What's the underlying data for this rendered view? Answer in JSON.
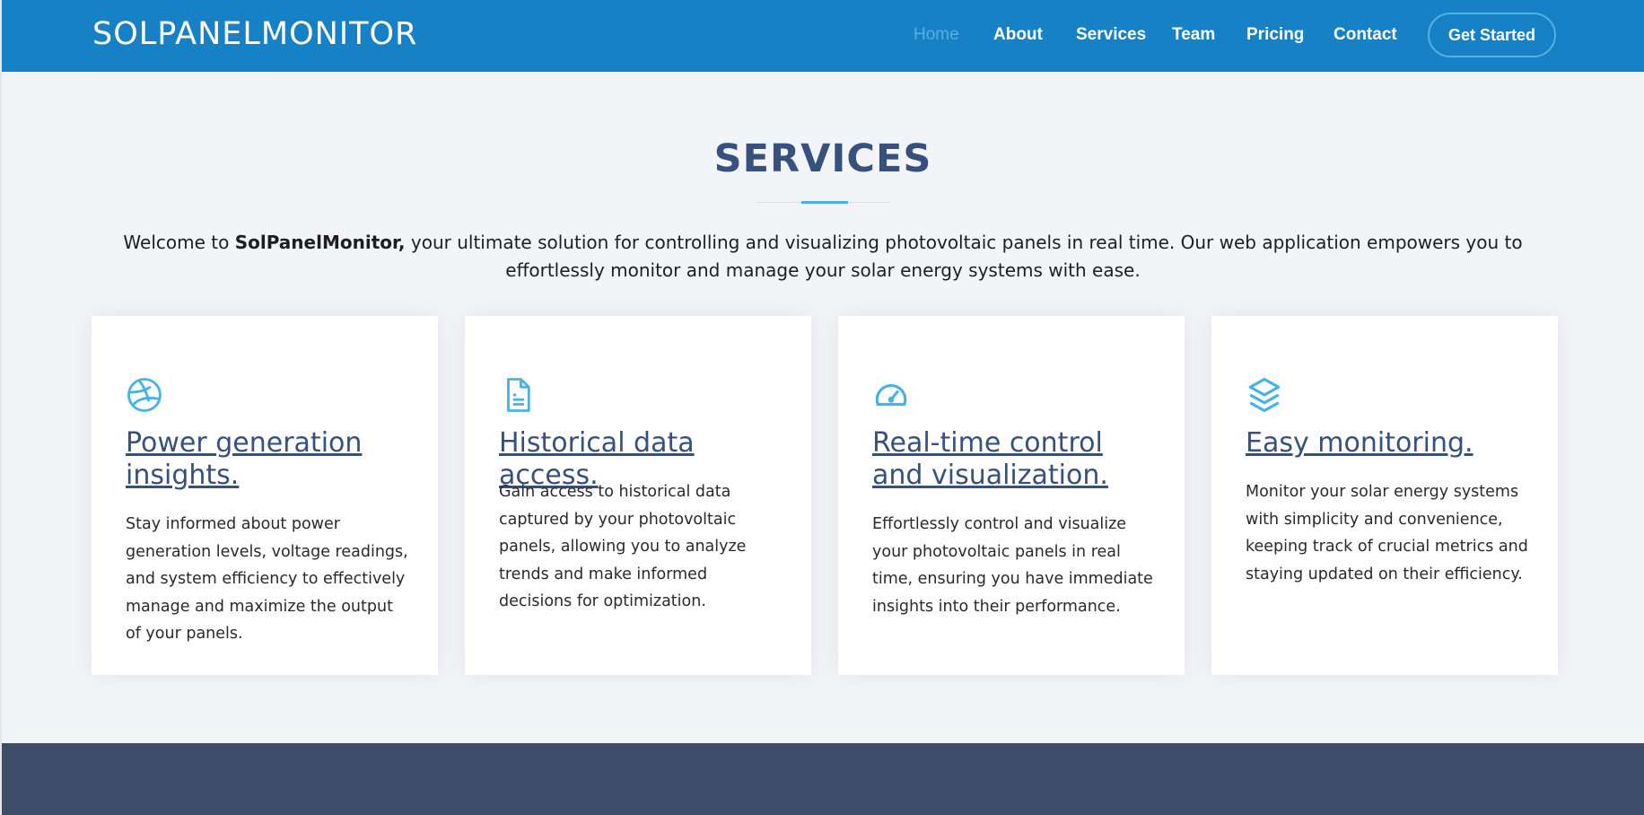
{
  "header": {
    "logo": "SOLPANELMONITOR",
    "nav": [
      {
        "label": "Home",
        "active": true
      },
      {
        "label": "About"
      },
      {
        "label": "Services"
      },
      {
        "label": "Team"
      },
      {
        "label": "Pricing"
      },
      {
        "label": "Contact"
      }
    ],
    "cta": "Get Started"
  },
  "section": {
    "title": "SERVICES",
    "intro_prefix": "Welcome to ",
    "intro_brand": "SolPanelMonitor,",
    "intro_rest": " your ultimate solution for controlling and visualizing photovoltaic panels in real time. Our web application empowers you to effortlessly monitor and manage your solar energy systems with ease."
  },
  "cards": [
    {
      "icon": "dribbble-icon",
      "title": "Power generation insights.",
      "text": "Stay informed about power generation levels, voltage readings, and system efficiency to effectively manage and maximize the output of your panels."
    },
    {
      "icon": "file-text-icon",
      "title": "Historical data access.",
      "text": "Gain access to historical data captured by your photovoltaic panels, allowing you to analyze trends and make informed decisions for optimization."
    },
    {
      "icon": "speedometer-icon",
      "title": "Real-time control and visualization.",
      "text": "Effortlessly control and visualize your photovoltaic panels in real time, ensuring you have immediate insights into their performance."
    },
    {
      "icon": "layers-icon",
      "title": "Easy monitoring.",
      "text": "Monitor your solar energy systems with simplicity and convenience, keeping track of crucial metrics and staying updated on their efficiency."
    }
  ],
  "colors": {
    "header_bg": "#1681c4",
    "accent": "#47b2e4",
    "title": "#37517e",
    "footer_bg": "#3d4d6a",
    "page_bg": "#f3f4f8"
  }
}
